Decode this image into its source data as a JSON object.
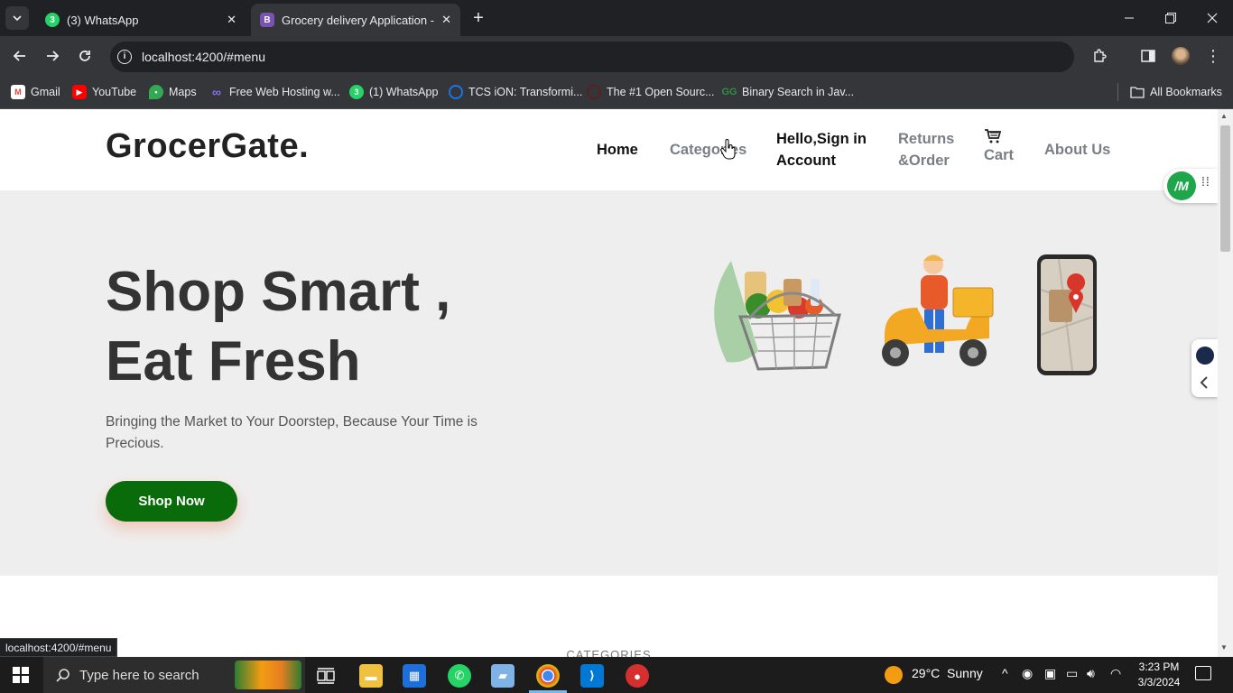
{
  "browser": {
    "tabs": [
      {
        "title": "(3) WhatsApp",
        "favicon": "whatsapp-icon",
        "badge": "3"
      },
      {
        "title": "Grocery delivery Application - I",
        "favicon": "bootstrap-icon",
        "badge": "B"
      }
    ],
    "url": "localhost:4200/#menu",
    "bookmarks": [
      {
        "label": "Gmail"
      },
      {
        "label": "YouTube"
      },
      {
        "label": "Maps"
      },
      {
        "label": "Free Web Hosting w..."
      },
      {
        "label": "(1) WhatsApp",
        "badge": "3"
      },
      {
        "label": "TCS iON: Transformi..."
      },
      {
        "label": "The #1 Open Sourc..."
      },
      {
        "label": "Binary Search in Jav..."
      }
    ],
    "all_bookmarks": "All Bookmarks",
    "status_url": "localhost:4200/#menu"
  },
  "site": {
    "brand": "GrocerGate.",
    "nav": {
      "home": "Home",
      "categories": "Categories",
      "signin_line1": "Hello,Sign in",
      "signin_line2": "Account",
      "returns_line1": "Returns",
      "returns_line2": "&Order",
      "cart": "Cart",
      "about": "About Us"
    },
    "hero": {
      "title_line1": "Shop Smart ,",
      "title_line2": "Eat Fresh",
      "subtitle": "Bringing the Market to Your Doorstep, Because Your Time is Precious.",
      "cta": "Shop Now"
    },
    "section_label": "CATEGORIES",
    "extension_badge": "/M"
  },
  "taskbar": {
    "search_placeholder": "Type here to search",
    "weather": "29°C  Sunny",
    "time": "3:23 PM",
    "date": "3/3/2024"
  },
  "colors": {
    "brand_green": "#0a6b0a",
    "hero_bg": "#efeeee",
    "nav_muted": "#6c757d"
  }
}
